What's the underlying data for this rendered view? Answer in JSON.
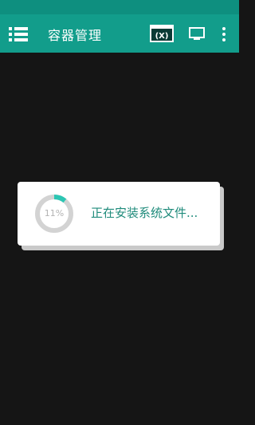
{
  "app_bar": {
    "title": "容器管理"
  },
  "icons": {
    "menu": "hamburger-menu-icon",
    "x_window": "x-window-icon",
    "monitor": "monitor-icon",
    "more": "more-vert-icon"
  },
  "dialog": {
    "progress_percent": 11,
    "progress_label": "11%",
    "message": "正在安装系统文件..."
  },
  "colors": {
    "accent": "#129d8b",
    "status_bar": "#0e8f7f",
    "background": "#151515",
    "progress_fill": "#2cc6b3",
    "progress_track": "#d3d3d3",
    "message_text": "#1f8b7b"
  }
}
